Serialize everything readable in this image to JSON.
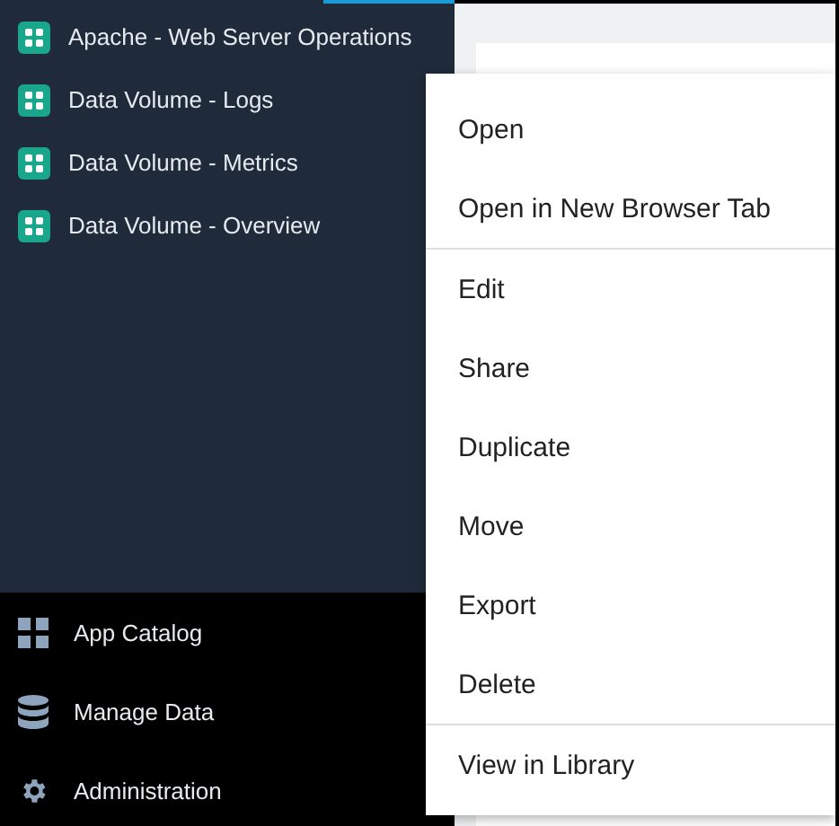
{
  "sidebar": {
    "dashboards": [
      {
        "label": "Apache - Web Server Operations"
      },
      {
        "label": "Data Volume - Logs"
      },
      {
        "label": "Data Volume - Metrics"
      },
      {
        "label": "Data Volume - Overview"
      }
    ],
    "nav": [
      {
        "label": "App Catalog",
        "kind": "catalog"
      },
      {
        "label": "Manage Data",
        "kind": "data"
      },
      {
        "label": "Administration",
        "kind": "admin"
      }
    ]
  },
  "context_menu": {
    "groups": [
      [
        "Open",
        "Open in New Browser Tab"
      ],
      [
        "Edit",
        "Share",
        "Duplicate",
        "Move",
        "Export",
        "Delete"
      ],
      [
        "View in Library"
      ]
    ]
  }
}
